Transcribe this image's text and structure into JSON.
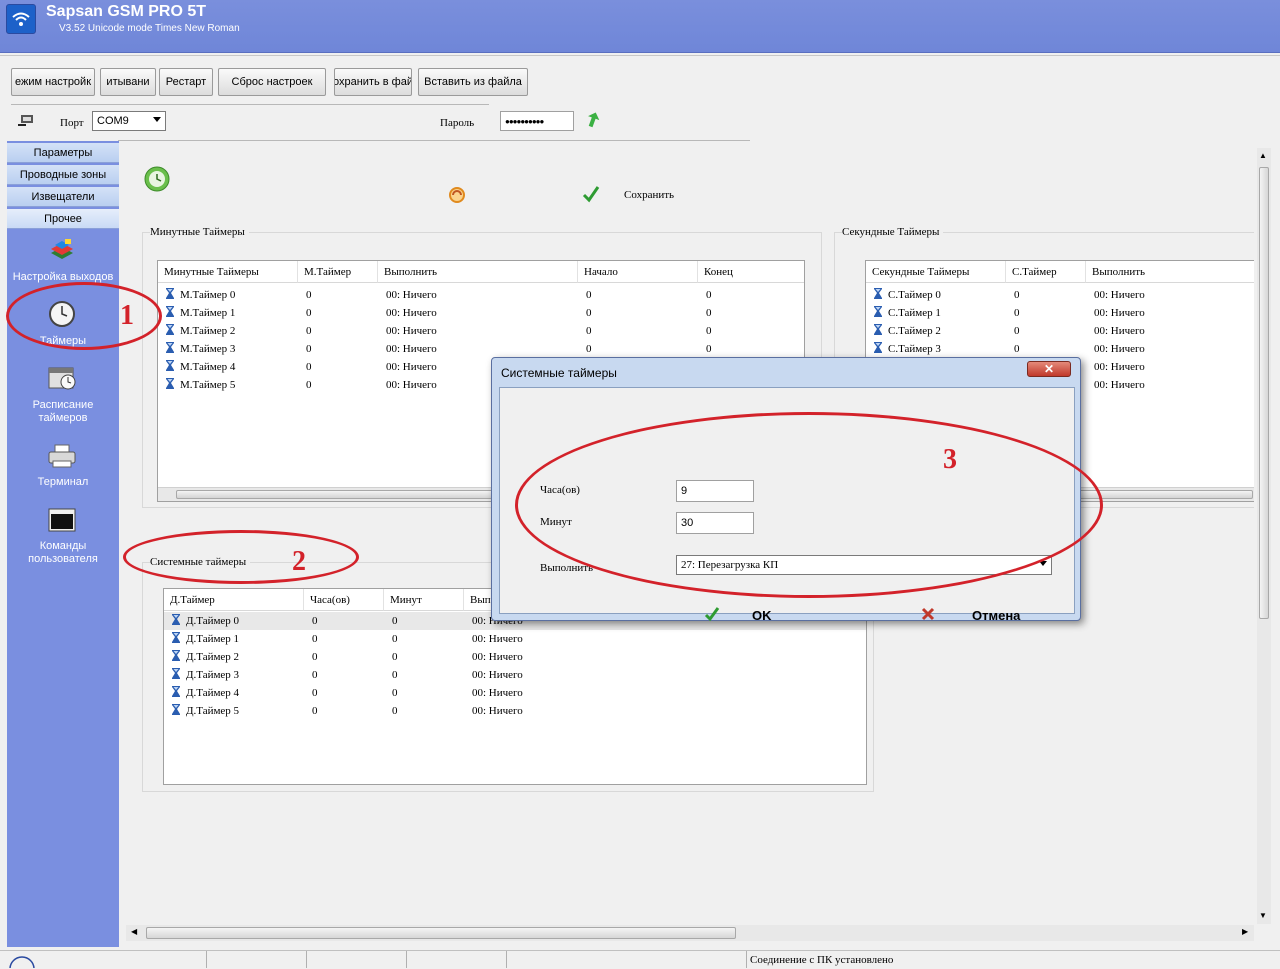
{
  "app": {
    "title": "Sapsan GSM PRO 5T",
    "subtitle": "V3.52 Unicode mode  Times New Roman"
  },
  "toolbar": {
    "buttons": [
      "ежим настройк",
      "итывани",
      "Рестарт",
      "Сброс настроек",
      "охранить в фай",
      "Вставить из файла"
    ]
  },
  "connection": {
    "port_label": "Порт",
    "port_value": "COM9",
    "password_label": "Пароль",
    "password_value": "●●●●●●●●●●"
  },
  "sidebar": {
    "nav": [
      "Параметры",
      "Проводные зоны",
      "Извещатели",
      "Прочее"
    ],
    "items": [
      {
        "label": "Настройка выходов",
        "icon": "outputs-icon"
      },
      {
        "label": "Таймеры",
        "icon": "clock-icon"
      },
      {
        "label": "Расписание таймеров",
        "icon": "schedule-clock-icon"
      },
      {
        "label": "Терминал",
        "icon": "printer-icon"
      },
      {
        "label": "Команды пользователя",
        "icon": "console-icon"
      }
    ]
  },
  "actions": {
    "save_label": "Сохранить"
  },
  "minute_timers": {
    "group_label": "Минутные Таймеры",
    "columns": [
      "Минутные Таймеры",
      "М.Таймер",
      "Выполнить",
      "Начало",
      "Конец"
    ],
    "rows": [
      [
        "М.Таймер 0",
        "0",
        "00: Ничего",
        "0",
        "0"
      ],
      [
        "М.Таймер 1",
        "0",
        "00: Ничего",
        "0",
        "0"
      ],
      [
        "М.Таймер 2",
        "0",
        "00: Ничего",
        "0",
        "0"
      ],
      [
        "М.Таймер 3",
        "0",
        "00: Ничего",
        "0",
        "0"
      ],
      [
        "М.Таймер 4",
        "0",
        "00: Ничего",
        "",
        ""
      ],
      [
        "М.Таймер 5",
        "0",
        "00: Ничего",
        "",
        ""
      ]
    ]
  },
  "second_timers": {
    "group_label": "Секундные Таймеры",
    "columns": [
      "Секундные Таймеры",
      "С.Таймер",
      "Выполнить"
    ],
    "rows": [
      [
        "С.Таймер 0",
        "0",
        "00: Ничего"
      ],
      [
        "С.Таймер 1",
        "0",
        "00: Ничего"
      ],
      [
        "С.Таймер 2",
        "0",
        "00: Ничего"
      ],
      [
        "С.Таймер 3",
        "0",
        "00: Ничего"
      ],
      [
        "",
        "",
        "00: Ничего"
      ],
      [
        "",
        "",
        "00: Ничего"
      ]
    ]
  },
  "system_timers": {
    "group_label": "Системные таймеры",
    "columns": [
      "Д.Таймер",
      "Часа(ов)",
      "Минут",
      "Вып"
    ],
    "rows": [
      [
        "Д.Таймер 0",
        "0",
        "0",
        "00: Ничего"
      ],
      [
        "Д.Таймер 1",
        "0",
        "0",
        "00: Ничего"
      ],
      [
        "Д.Таймер 2",
        "0",
        "0",
        "00: Ничего"
      ],
      [
        "Д.Таймер 3",
        "0",
        "0",
        "00: Ничего"
      ],
      [
        "Д.Таймер 4",
        "0",
        "0",
        "00: Ничего"
      ],
      [
        "Д.Таймер 5",
        "0",
        "0",
        "00: Ничего"
      ]
    ]
  },
  "dialog": {
    "title": "Системные таймеры",
    "hours_label": "Часа(ов)",
    "hours_value": "9",
    "minutes_label": "Минут",
    "minutes_value": "30",
    "action_label": "Выполнить",
    "action_value": "27: Перезагрузка КП",
    "ok_label": "OK",
    "cancel_label": "Отмена"
  },
  "annotations": [
    "1",
    "2",
    "3"
  ],
  "status": {
    "message": "Соединение с ПК установлено"
  },
  "colors": {
    "titlebar": "#7088d8",
    "sidebar": "#7a8fe0",
    "annotation": "#d3222a"
  }
}
